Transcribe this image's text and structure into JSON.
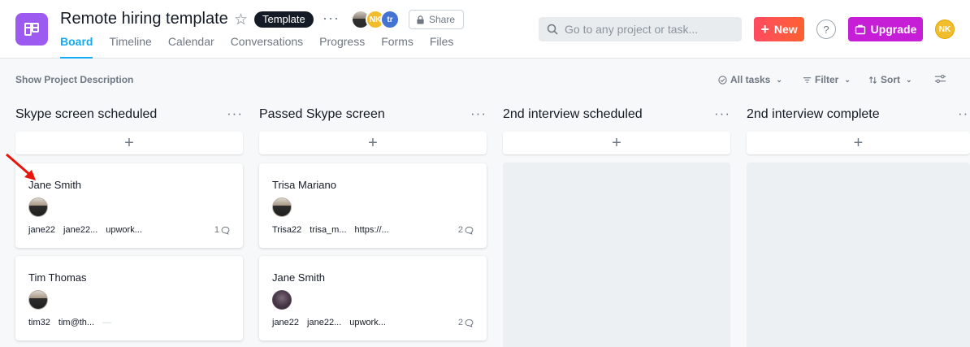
{
  "header": {
    "title": "Remote hiring template",
    "badge": "Template",
    "more": "···",
    "members": [
      {
        "initials": ""
      },
      {
        "initials": "NK"
      },
      {
        "initials": "tr"
      }
    ],
    "share_label": "Share",
    "tabs": [
      {
        "label": "Board",
        "active": true
      },
      {
        "label": "Timeline"
      },
      {
        "label": "Calendar"
      },
      {
        "label": "Conversations"
      },
      {
        "label": "Progress"
      },
      {
        "label": "Forms"
      },
      {
        "label": "Files"
      }
    ],
    "search_placeholder": "Go to any project or task...",
    "new_label": "New",
    "help_label": "?",
    "upgrade_label": "Upgrade",
    "user_initials": "NK"
  },
  "toolbar": {
    "show_description": "Show Project Description",
    "all_tasks": "All tasks",
    "filter": "Filter",
    "sort": "Sort"
  },
  "columns": [
    {
      "title": "Skype screen scheduled",
      "add_label": "+",
      "cards": [
        {
          "name": "Jane Smith",
          "avatar": "suit",
          "fields": [
            "jane22",
            "jane22...",
            "upwork..."
          ],
          "comments": "1"
        },
        {
          "name": "Tim Thomas",
          "avatar": "suit",
          "fields": [
            "tim32",
            "tim@th...",
            "—"
          ],
          "comments": ""
        }
      ]
    },
    {
      "title": "Passed Skype screen",
      "add_label": "+",
      "cards": [
        {
          "name": "Trisa Mariano",
          "avatar": "suit",
          "fields": [
            "Trisa22",
            "trisa_m...",
            "https://..."
          ],
          "comments": "2"
        },
        {
          "name": "Jane Smith",
          "avatar": "dark",
          "fields": [
            "jane22",
            "jane22...",
            "upwork..."
          ],
          "comments": "2"
        }
      ]
    },
    {
      "title": "2nd interview scheduled",
      "add_label": "+",
      "cards": []
    },
    {
      "title": "2nd interview complete",
      "add_label": "+",
      "cards": []
    }
  ],
  "colors": {
    "accent": "#14aaf5",
    "project_icon": "#9c5af0",
    "new_button": "#ff4a62",
    "upgrade_button": "#c61ed6",
    "annotation_arrow": "#e8150d"
  }
}
